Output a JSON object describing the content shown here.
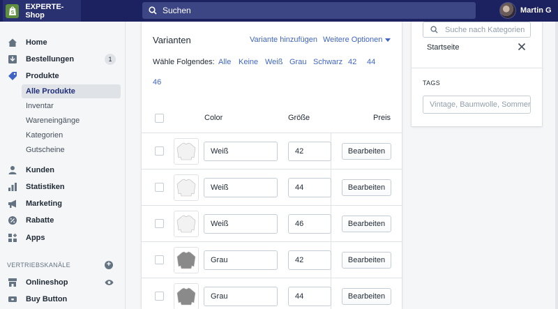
{
  "topbar": {
    "shop_name": "EXPERTE-Shop",
    "search_placeholder": "Suchen",
    "user_name": "Martin G"
  },
  "sidebar": {
    "items": [
      {
        "label": "Home",
        "icon": "home-icon"
      },
      {
        "label": "Bestellungen",
        "icon": "orders-icon",
        "badge": "1"
      },
      {
        "label": "Produkte",
        "icon": "tag-icon"
      },
      {
        "label": "Kunden",
        "icon": "person-icon"
      },
      {
        "label": "Statistiken",
        "icon": "bar-chart-icon"
      },
      {
        "label": "Marketing",
        "icon": "megaphone-icon"
      },
      {
        "label": "Rabatte",
        "icon": "discount-icon"
      },
      {
        "label": "Apps",
        "icon": "apps-icon"
      }
    ],
    "product_subitems": [
      "Alle Produkte",
      "Inventar",
      "Wareneingänge",
      "Kategorien",
      "Gutscheine"
    ],
    "sales_channels_label": "VERTRIEBSKANÄLE",
    "channels": [
      {
        "label": "Onlineshop",
        "icon": "store-icon"
      },
      {
        "label": "Buy Button",
        "icon": "buy-button-icon"
      }
    ]
  },
  "variants": {
    "title": "Varianten",
    "add_variant": "Variante hinzufügen",
    "more_options": "Weitere Optionen",
    "select_label": "Wähle Folgendes:",
    "filters": [
      "Alle",
      "Keine",
      "Weiß",
      "Grau",
      "Schwarz",
      "42",
      "44",
      "46"
    ],
    "columns": {
      "color": "Color",
      "size": "Größe",
      "price": "Preis"
    },
    "rows": [
      {
        "color": "Weiß",
        "size": "42",
        "action": "Bearbeiten",
        "shirt_color": "#f2f2f2"
      },
      {
        "color": "Weiß",
        "size": "44",
        "action": "Bearbeiten",
        "shirt_color": "#f2f2f2"
      },
      {
        "color": "Weiß",
        "size": "46",
        "action": "Bearbeiten",
        "shirt_color": "#f2f2f2"
      },
      {
        "color": "Grau",
        "size": "42",
        "action": "Bearbeiten",
        "shirt_color": "#8a8a8a"
      },
      {
        "color": "Grau",
        "size": "44",
        "action": "Bearbeiten",
        "shirt_color": "#8a8a8a"
      }
    ]
  },
  "organization": {
    "category_search_placeholder": "Suche nach Kategorien",
    "category_item": "Startseite",
    "tags_label": "TAGS",
    "tags_placeholder": "Vintage, Baumwolle, Sommer"
  },
  "colors": {
    "topbar_bg": "#1c2260",
    "link": "#3f64c4",
    "brand": "#5e8e3e"
  }
}
